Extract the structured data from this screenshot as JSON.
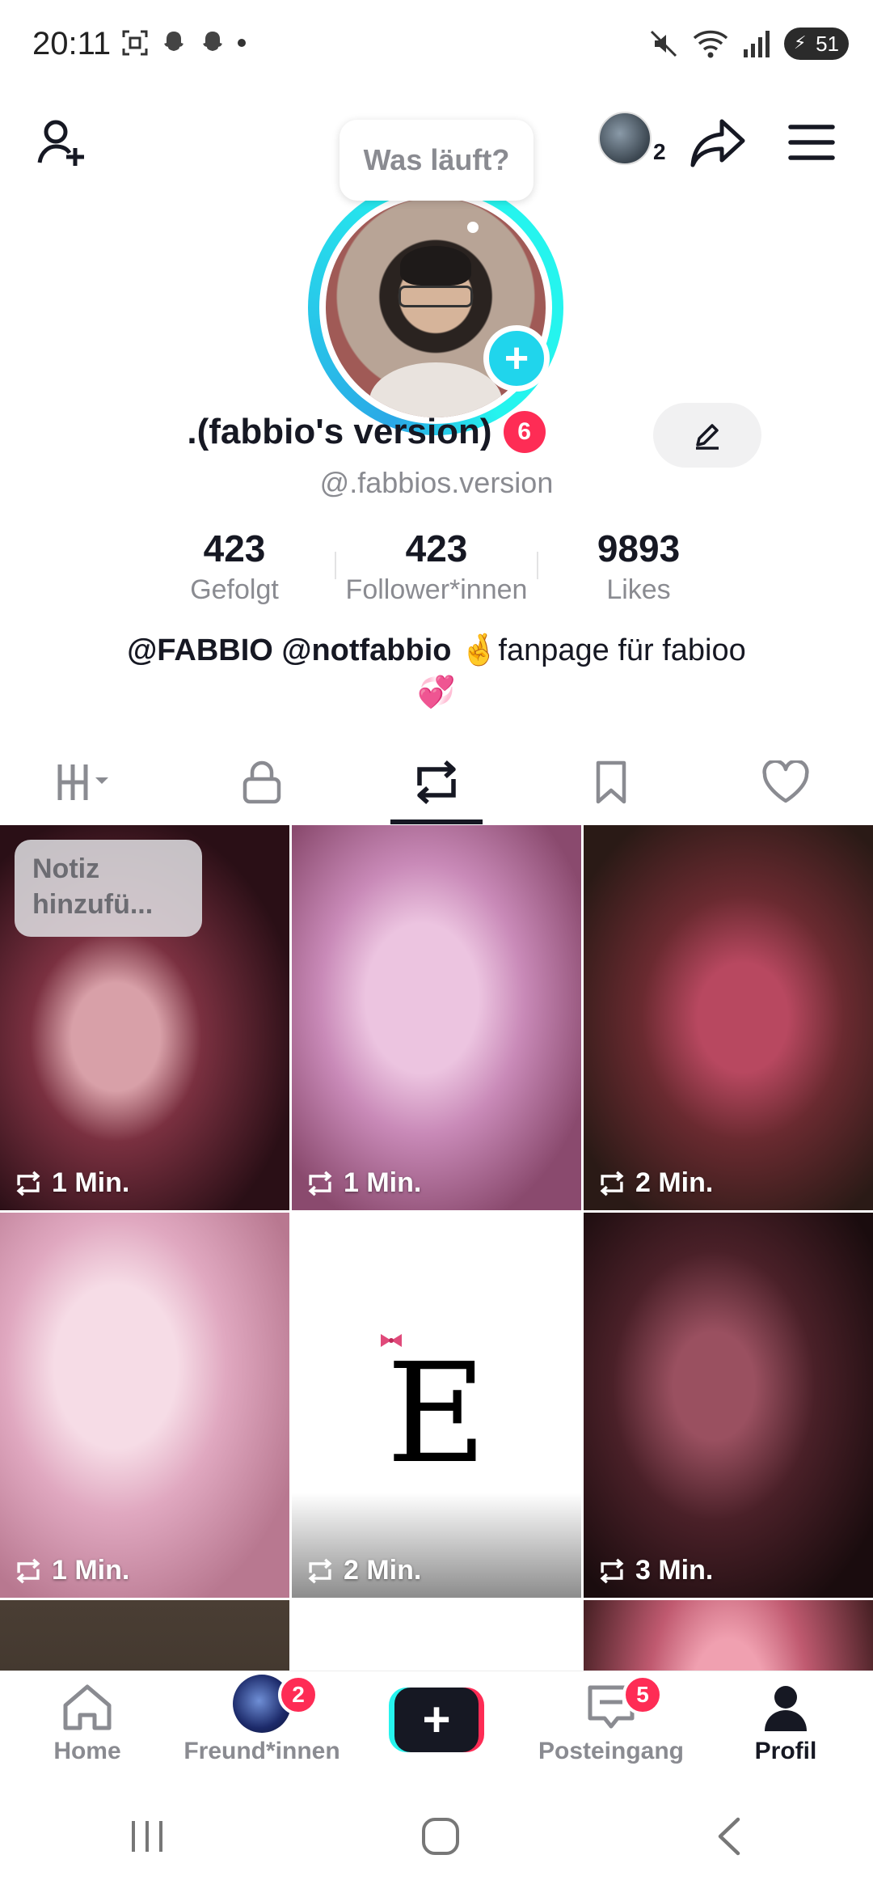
{
  "status_bar": {
    "time": "20:11",
    "battery": "51"
  },
  "header": {
    "notification_count": "2",
    "icons": [
      "add-user-icon",
      "avatar",
      "share-icon",
      "menu-icon"
    ]
  },
  "profile": {
    "bubble_text": "Was läuft?",
    "display_name": ".(fabbio's version)",
    "name_badge": "6",
    "username": "@.fabbios.version",
    "stats": [
      {
        "value": "423",
        "label": "Gefolgt"
      },
      {
        "value": "423",
        "label": "Follower*innen"
      },
      {
        "value": "9893",
        "label": "Likes"
      }
    ],
    "bio_line1_bold": "@FABBIO @notfabbio",
    "bio_line1_emoji": "🤞",
    "bio_line1_text": "fanpage für fabioo",
    "bio_line2_emoji": "💞"
  },
  "tabs": [
    {
      "name": "videos",
      "icon": "grid-icon"
    },
    {
      "name": "private",
      "icon": "lock-icon"
    },
    {
      "name": "reposts",
      "icon": "repost-icon",
      "active": true
    },
    {
      "name": "favorites",
      "icon": "bookmark-icon"
    },
    {
      "name": "liked",
      "icon": "heart-icon"
    }
  ],
  "grid": {
    "note_text": "Notiz hinzufü...",
    "items": [
      {
        "time": "1 Min."
      },
      {
        "time": "1 Min."
      },
      {
        "time": "2 Min."
      },
      {
        "time": "1 Min."
      },
      {
        "time": "2 Min.",
        "letter": "E"
      },
      {
        "time": "3 Min."
      }
    ]
  },
  "bottom_nav": {
    "home": "Home",
    "friends": "Freund*innen",
    "friends_badge": "2",
    "inbox": "Posteingang",
    "inbox_badge": "5",
    "profile": "Profil"
  }
}
